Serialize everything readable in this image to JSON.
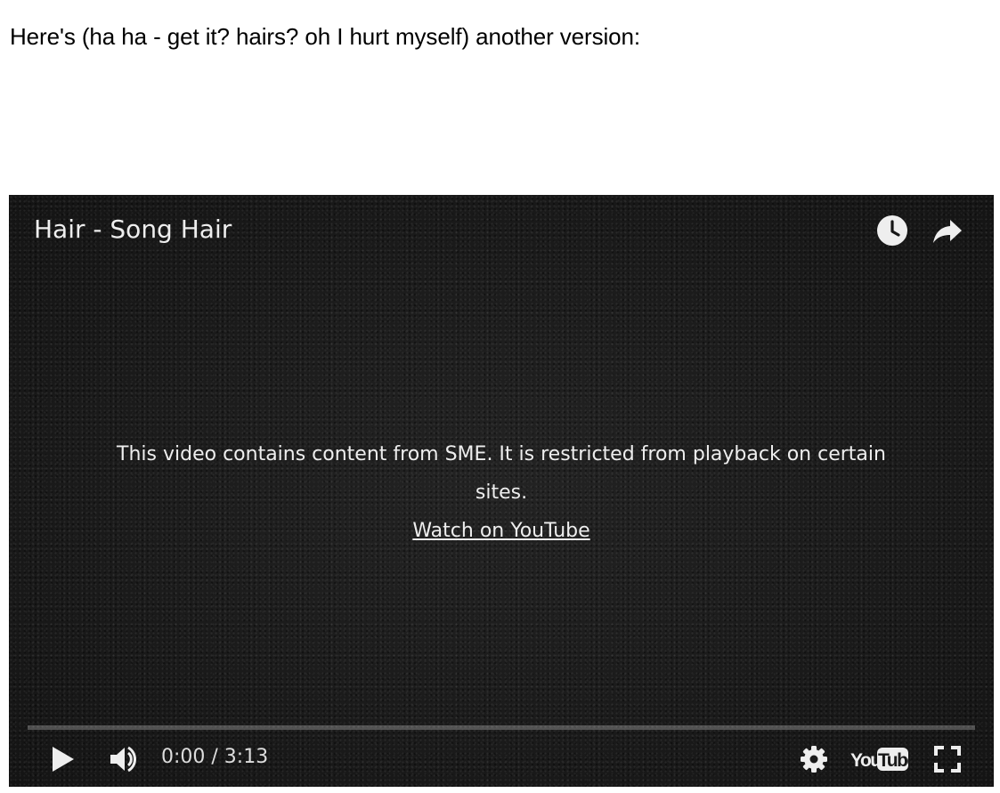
{
  "post": {
    "text": "Here's (ha ha - get it? hairs? oh I hurt myself) another version:"
  },
  "player": {
    "title": "Hair - Song Hair",
    "message": "This video contains content from SME. It is restricted from playback on certain sites.",
    "watch_link": "Watch on YouTube",
    "time": "0:00 / 3:13",
    "progress": 0,
    "logo_text_you": "You",
    "logo_text_tube": "Tube",
    "icons": {
      "watch_later": "clock-icon",
      "share": "share-arrow-icon",
      "play": "play-icon",
      "volume": "volume-icon",
      "settings": "gear-icon",
      "logo": "youtube-logo",
      "fullscreen": "fullscreen-icon"
    },
    "colors": {
      "background": "#161616",
      "text": "#eeeeee",
      "progress_track": "#4a4a4a",
      "progress_fill": "#ff0000"
    }
  }
}
